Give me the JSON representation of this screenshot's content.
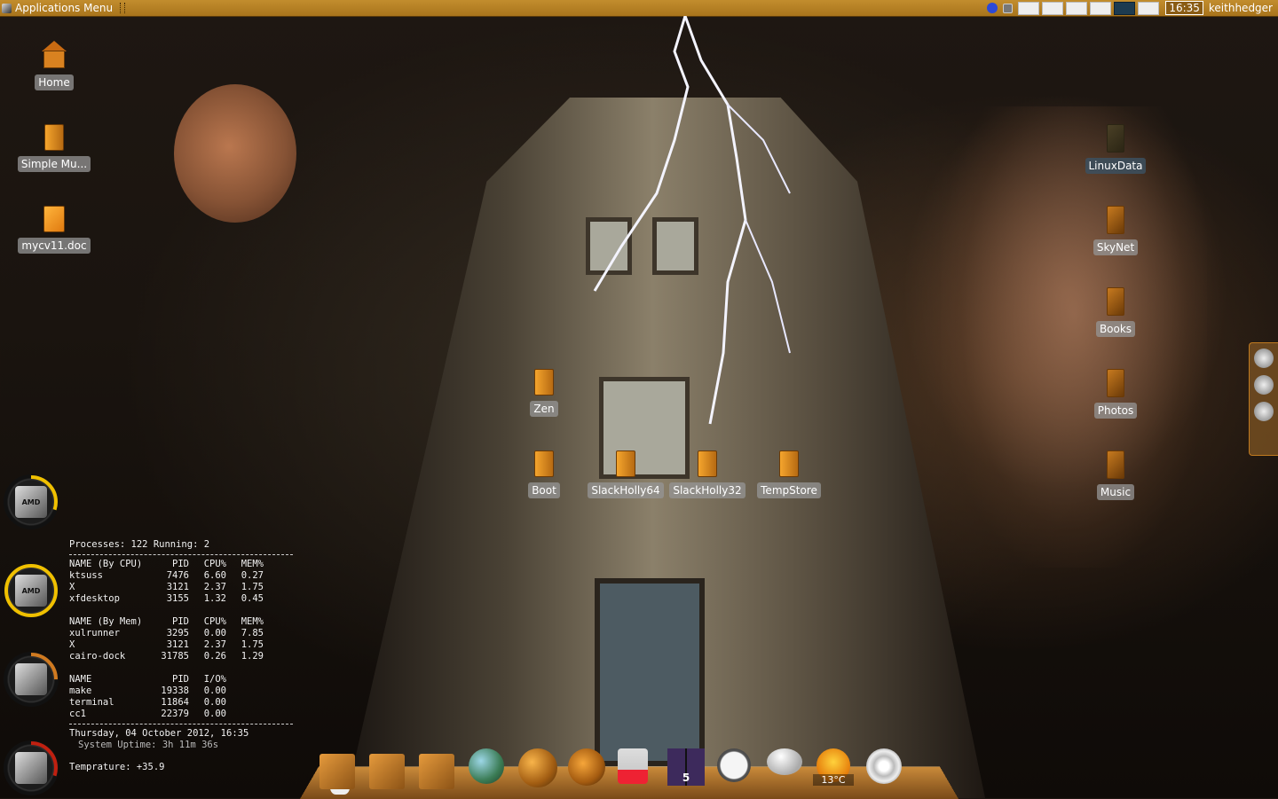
{
  "panel": {
    "app_menu_label": "Applications Menu",
    "clock": "16:35",
    "user": "keithhedger",
    "workspaces": 5,
    "active_workspace": 5
  },
  "desktop_icons": {
    "home": "Home",
    "simple_mu": "Simple Mu...",
    "mycv": "mycv11.doc",
    "linuxdata": "LinuxData",
    "skynet": "SkyNet",
    "books": "Books",
    "photos": "Photos",
    "music": "Music",
    "zen": "Zen",
    "boot": "Boot",
    "slackholly64": "SlackHolly64",
    "slackholly32": "SlackHolly32",
    "tempstore": "TempStore"
  },
  "conky": {
    "processes": "Processes: 122  Running: 2",
    "cpu_header": [
      "NAME (By CPU)",
      "PID",
      "CPU%",
      "MEM%"
    ],
    "cpu_rows": [
      [
        "ktsuss",
        "7476",
        "6.60",
        "0.27"
      ],
      [
        "X",
        "3121",
        "2.37",
        "1.75"
      ],
      [
        "xfdesktop",
        "3155",
        "1.32",
        "0.45"
      ]
    ],
    "mem_header": [
      "NAME (By Mem)",
      "PID",
      "CPU%",
      "MEM%"
    ],
    "mem_rows": [
      [
        "xulrunner",
        "3295",
        "0.00",
        "7.85"
      ],
      [
        "X",
        "3121",
        "2.37",
        "1.75"
      ],
      [
        "cairo-dock",
        "31785",
        "0.26",
        "1.29"
      ]
    ],
    "io_header": [
      "NAME",
      "PID",
      "I/O%"
    ],
    "io_rows": [
      [
        "make",
        "19338",
        "0.00"
      ],
      [
        "terminal",
        "11864",
        "0.00"
      ],
      [
        "cc1",
        "22379",
        "0.00"
      ]
    ],
    "datetime": "Thursday, 04 October 2012, 16:35",
    "uptime": "System Uptime: 3h 11m 36s",
    "temperature": "Temprature: +35.9"
  },
  "gauges": {
    "cpu1_label": "AMD",
    "cpu2_label": "AMD",
    "cpu1_level": 0.3,
    "cpu2_level": 1.0,
    "mem_level": 0.25,
    "temp_level": 0.3
  },
  "dock": {
    "workspace_count": "5",
    "weather": "13°C"
  },
  "colors": {
    "panel": "#b07c22",
    "accent": "#f0a030",
    "gauge_yellow": "#f0c000",
    "gauge_red": "#c02010"
  }
}
